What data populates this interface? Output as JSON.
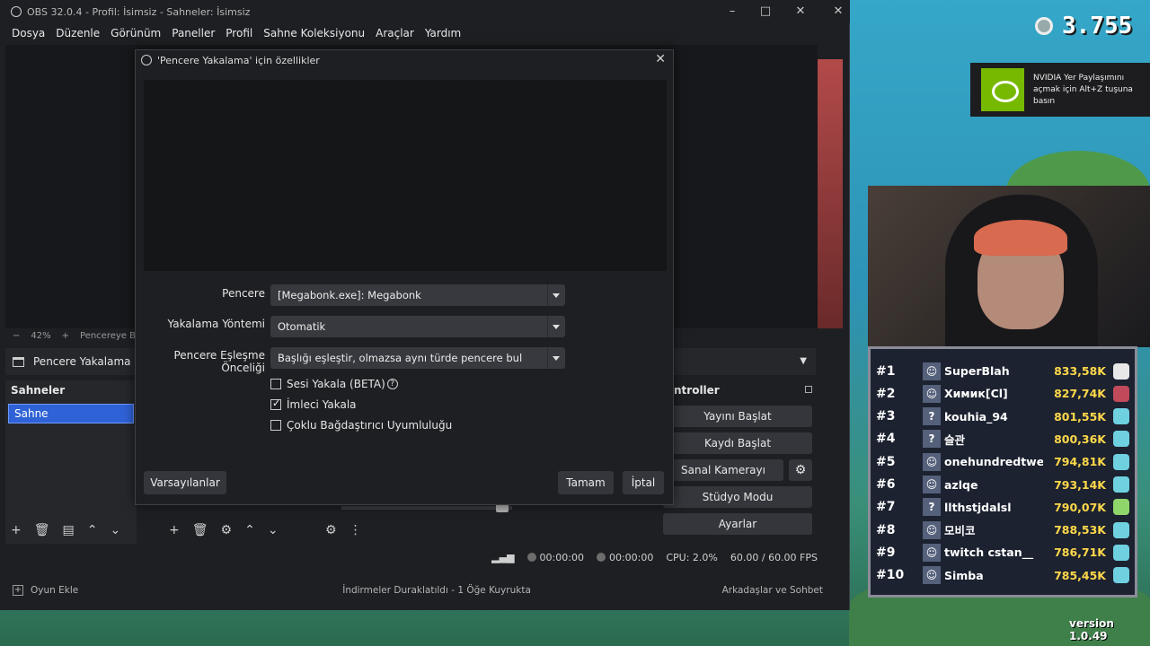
{
  "obs": {
    "title": "OBS 32.0.4 - Profil: İsimsiz - Sahneler: İsimsiz",
    "menu": [
      "Dosya",
      "Düzenle",
      "Görünüm",
      "Paneller",
      "Profil",
      "Sahne Koleksiyonu",
      "Araçlar",
      "Yardım"
    ],
    "zoom": "42%",
    "zoom_fit": "Pencereye Boy",
    "source_label": "Pencere Yakalama",
    "scenes_title": "Sahneler",
    "scenes": [
      "Sahne"
    ],
    "controls_title": "ntroller",
    "controls": [
      "Yayını Başlat",
      "Kaydı Başlat",
      "Sanal Kamerayı Başlat",
      "Stüdyo Modu",
      "Ayarlar"
    ],
    "status": {
      "stream_time": "00:00:00",
      "record_time": "00:00:00",
      "cpu": "CPU: 2.0%",
      "fps": "60.00 / 60.00 FPS"
    }
  },
  "steam": {
    "add_game": "Oyun Ekle",
    "downloads": "İndirmeler Duraklatıldı - 1 Öğe Kuyrukta",
    "friends": "Arkadaşlar ve Sohbet"
  },
  "dialog": {
    "title": "'Pencere Yakalama' için özellikler",
    "fields": {
      "window_label": "Pencere",
      "window_value": "[Megabonk.exe]: Megabonk",
      "method_label": "Yakalama Yöntemi",
      "method_value": "Otomatik",
      "priority_label": "Pencere Eşleşme Önceliği",
      "priority_value": "Başlığı eşleştir, olmazsa aynı türde pencere bul"
    },
    "checkboxes": [
      {
        "label": "Sesi Yakala (BETA)",
        "checked": false
      },
      {
        "label": "İmleci Yakala",
        "checked": true
      },
      {
        "label": "Çoklu Bağdaştırıcı Uyumluluğu",
        "checked": false
      }
    ],
    "buttons": {
      "defaults": "Varsayılanlar",
      "ok": "Tamam",
      "cancel": "İptal"
    }
  },
  "hud": {
    "coins": "3.755",
    "nvidia_text": "NVIDIA Yer Paylaşımını açmak için Alt+Z tuşuna basın",
    "version": "version 1.0.49"
  },
  "leaderboard": [
    {
      "rank": "#1",
      "name": "SuperBlah",
      "score": "833,58K",
      "avatar": "☺",
      "badge_color": "#e8e8e8"
    },
    {
      "rank": "#2",
      "name": "Химик[Cl]",
      "score": "827,74K",
      "avatar": "☺",
      "badge_color": "#c04a5a"
    },
    {
      "rank": "#3",
      "name": "kouhia_94",
      "score": "801,55K",
      "avatar": "?",
      "badge_color": "#6fd0e0"
    },
    {
      "rank": "#4",
      "name": "슬관",
      "score": "800,36K",
      "avatar": "?",
      "badge_color": "#6fd0e0"
    },
    {
      "rank": "#5",
      "name": "onehundredtwe",
      "score": "794,81K",
      "avatar": "☺",
      "badge_color": "#6fd0e0"
    },
    {
      "rank": "#6",
      "name": "azlqe",
      "score": "793,14K",
      "avatar": "☺",
      "badge_color": "#6fd0e0"
    },
    {
      "rank": "#7",
      "name": "llthstjdalsl",
      "score": "790,07K",
      "avatar": "?",
      "badge_color": "#8fd66a"
    },
    {
      "rank": "#8",
      "name": "모비코",
      "score": "788,53K",
      "avatar": "☺",
      "badge_color": "#6fd0e0"
    },
    {
      "rank": "#9",
      "name": "twitch cstan__",
      "score": "786,71K",
      "avatar": "☺",
      "badge_color": "#6fd0e0"
    },
    {
      "rank": "#10",
      "name": "Simba",
      "score": "785,45K",
      "avatar": "☺",
      "badge_color": "#6fd0e0"
    }
  ]
}
